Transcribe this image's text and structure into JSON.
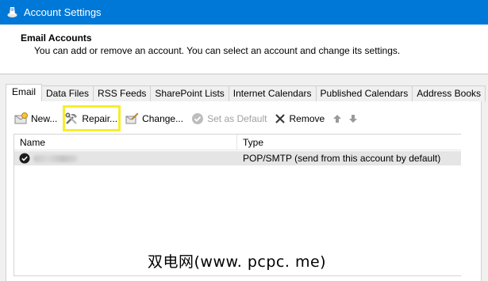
{
  "window": {
    "title": "Account Settings",
    "accent": "#0078d7"
  },
  "header": {
    "title": "Email Accounts",
    "description": "You can add or remove an account. You can select an account and change its settings."
  },
  "tabs": [
    {
      "label": "Email",
      "active": true
    },
    {
      "label": "Data Files"
    },
    {
      "label": "RSS Feeds"
    },
    {
      "label": "SharePoint Lists"
    },
    {
      "label": "Internet Calendars"
    },
    {
      "label": "Published Calendars"
    },
    {
      "label": "Address Books"
    }
  ],
  "toolbar": {
    "new_label": "New...",
    "repair_label": "Repair...",
    "change_label": "Change...",
    "set_default_label": "Set as Default",
    "remove_label": "Remove",
    "highlight_color": "#f6ee2c"
  },
  "list": {
    "columns": {
      "name": "Name",
      "type": "Type"
    },
    "rows": [
      {
        "name": "",
        "type": "POP/SMTP (send from this account by default)",
        "default": true,
        "name_obscured": true
      }
    ]
  },
  "watermark": "双电网(www. pcpc. me)",
  "icons": [
    "app-icon",
    "new-account-icon",
    "repair-icon",
    "change-icon",
    "set-default-icon",
    "remove-icon",
    "move-up-icon",
    "move-down-icon",
    "default-check-icon"
  ]
}
